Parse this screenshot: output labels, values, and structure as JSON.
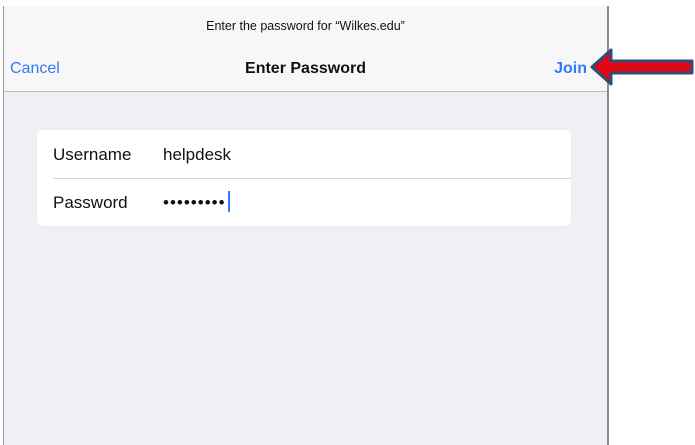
{
  "dialog": {
    "prompt": "Enter the password for “Wilkes.edu”",
    "cancel_label": "Cancel",
    "title": "Enter Password",
    "join_label": "Join"
  },
  "form": {
    "username_label": "Username",
    "username_value": "helpdesk",
    "password_label": "Password",
    "password_masked": "•••••••••"
  },
  "colors": {
    "accent": "#2e7cf6",
    "arrow_fill": "#e30613",
    "arrow_stroke": "#2f4c7a"
  },
  "annotation": {
    "icon": "red-arrow-icon"
  }
}
